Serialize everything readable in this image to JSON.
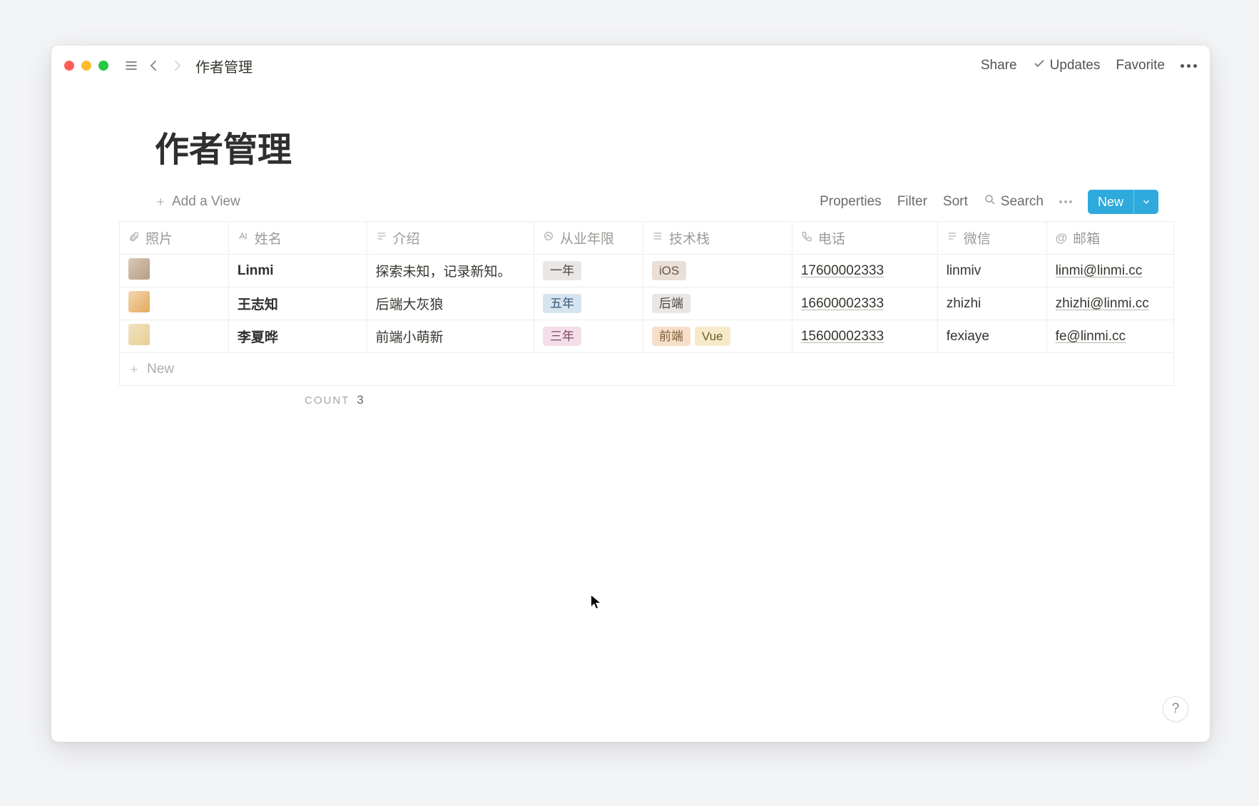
{
  "breadcrumb": "作者管理",
  "page_title": "作者管理",
  "topbar": {
    "share": "Share",
    "updates": "Updates",
    "favorite": "Favorite"
  },
  "toolbar": {
    "add_view": "Add a View",
    "properties": "Properties",
    "filter": "Filter",
    "sort": "Sort",
    "search": "Search",
    "new": "New"
  },
  "columns": {
    "photo": "照片",
    "name": "姓名",
    "intro": "介绍",
    "years": "从业年限",
    "stack": "技术栈",
    "phone": "电话",
    "wechat": "微信",
    "email": "邮箱"
  },
  "rows": [
    {
      "name": "Linmi",
      "intro": "探索未知，记录新知。",
      "years": {
        "label": "一年",
        "color": "gray"
      },
      "stack": [
        {
          "label": "iOS",
          "color": "brown"
        }
      ],
      "phone": "17600002333",
      "wechat": "linmiv",
      "email": "linmi@linmi.cc"
    },
    {
      "name": "王志知",
      "intro": "后端大灰狼",
      "years": {
        "label": "五年",
        "color": "blue"
      },
      "stack": [
        {
          "label": "后端",
          "color": "gray"
        }
      ],
      "phone": "16600002333",
      "wechat": "zhizhi",
      "email": "zhizhi@linmi.cc"
    },
    {
      "name": "李夏晔",
      "intro": "前端小萌新",
      "years": {
        "label": "三年",
        "color": "pink"
      },
      "stack": [
        {
          "label": "前端",
          "color": "orange"
        },
        {
          "label": "Vue",
          "color": "yellow"
        }
      ],
      "phone": "15600002333",
      "wechat": "fexiaye",
      "email": "fe@linmi.cc"
    }
  ],
  "new_row": "New",
  "count": {
    "label": "COUNT",
    "value": "3"
  },
  "help": "?"
}
